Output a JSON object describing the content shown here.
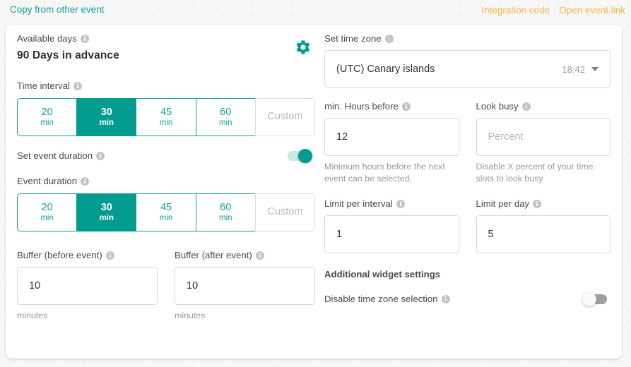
{
  "topbar": {
    "copy_from_other_event": "Copy from other event",
    "integration_code": "Integration code",
    "open_event_link": "Open event link"
  },
  "left": {
    "available_days": {
      "label": "Available days",
      "value": "90 Days in advance",
      "gear_icon": "gear-icon"
    },
    "time_interval": {
      "label": "Time interval",
      "options": [
        {
          "num": "20",
          "unit": "min"
        },
        {
          "num": "30",
          "unit": "min"
        },
        {
          "num": "45",
          "unit": "min"
        },
        {
          "num": "60",
          "unit": "min"
        }
      ],
      "custom_label": "Custom",
      "selected": "30"
    },
    "set_event_duration": {
      "label": "Set event duration",
      "enabled": true
    },
    "event_duration": {
      "label": "Event duration",
      "options": [
        {
          "num": "20",
          "unit": "min"
        },
        {
          "num": "30",
          "unit": "min"
        },
        {
          "num": "45",
          "unit": "min"
        },
        {
          "num": "60",
          "unit": "min"
        }
      ],
      "custom_label": "Custom",
      "selected": "30"
    },
    "buffer_before": {
      "label": "Buffer (before event)",
      "value": "10",
      "helper": "minutes"
    },
    "buffer_after": {
      "label": "Buffer (after event)",
      "value": "10",
      "helper": "minutes"
    }
  },
  "right": {
    "time_zone": {
      "label": "Set time zone",
      "value": "(UTC) Canary islands",
      "time": "18:42"
    },
    "min_hours_before": {
      "label": "min. Hours before",
      "value": "12",
      "helper": "Minimum hours before the next event can be selected."
    },
    "look_busy": {
      "label": "Look busy",
      "placeholder": "Percent",
      "helper": "Disable X percent of your time slots to look busy"
    },
    "limit_per_interval": {
      "label": "Limit per interval",
      "value": "1"
    },
    "limit_per_day": {
      "label": "Limit per day",
      "value": "5"
    },
    "additional_widget_settings": {
      "title": "Additional widget settings",
      "disable_tz_label": "Disable time zone selection",
      "disable_tz_enabled": false
    }
  },
  "colors": {
    "accent_teal": "#14a098",
    "selected_teal": "#019c8f",
    "amber": "#f5b53f"
  }
}
